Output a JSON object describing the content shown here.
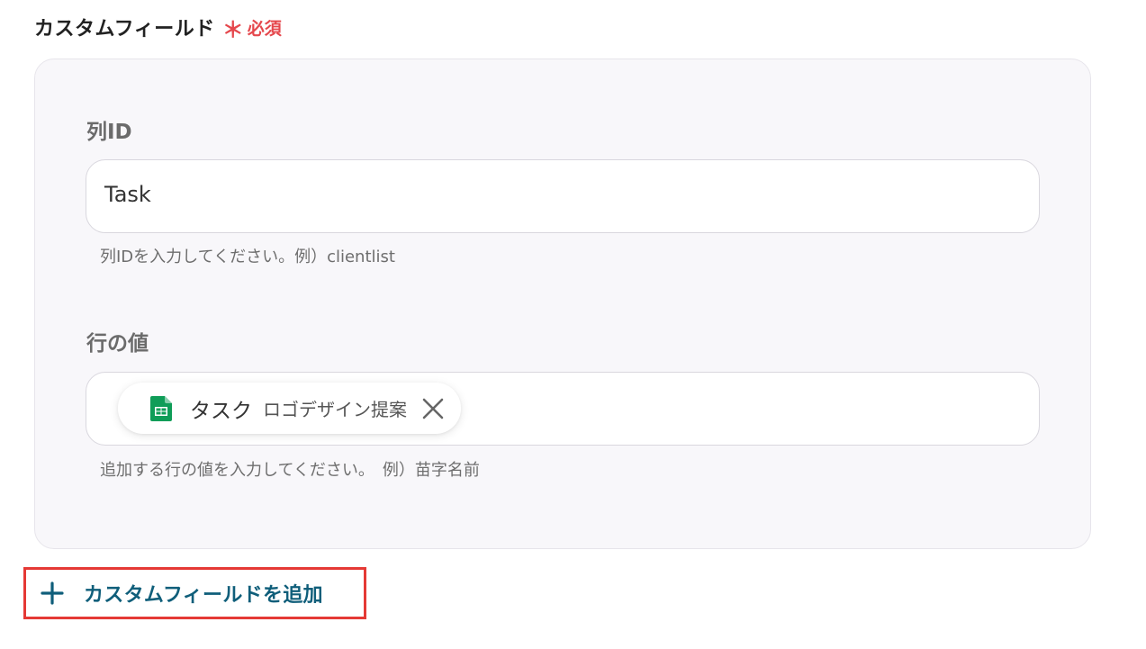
{
  "section": {
    "title": "カスタムフィールド",
    "required_mark": "＊",
    "required_label": "必須"
  },
  "column_id": {
    "label": "列ID",
    "value": "Task",
    "hint": "列IDを入力してください。例）clientlist"
  },
  "row_value": {
    "label": "行の値",
    "chip": {
      "icon": "google-sheets-icon",
      "label": "タスク",
      "value": "ロゴデザイン提案"
    },
    "hint": "追加する行の値を入力してください。　例）苗字名前"
  },
  "add_button": {
    "icon": "plus-icon",
    "label": "カスタムフィールドを追加"
  },
  "colors": {
    "required": "#e5484d",
    "link": "#0f5e7a",
    "highlight_border": "#e53935",
    "sheets_green": "#0f9d58"
  }
}
